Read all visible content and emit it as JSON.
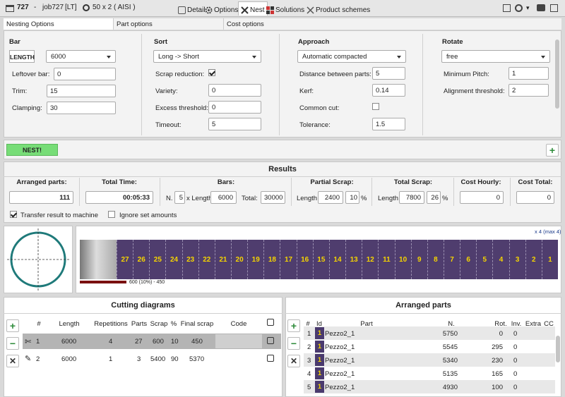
{
  "titlebar": {
    "job_number": "727",
    "dash": "-",
    "job_name": "job727",
    "job_tag": "[LT]",
    "profile": "50 x 2 ( AISI )",
    "tabs": [
      {
        "label": "Detail"
      },
      {
        "label": "Options"
      },
      {
        "label": "Nest"
      },
      {
        "label": "Solutions"
      },
      {
        "label": "Product schemes"
      }
    ]
  },
  "subtabs": [
    "Nesting Options",
    "Part options",
    "Cost options"
  ],
  "bar": {
    "header": "Bar",
    "length_btn": "LENGTH",
    "length_value": "6000",
    "leftover_label": "Leftover bar:",
    "leftover_value": "0",
    "trim_label": "Trim:",
    "trim_value": "15",
    "clamping_label": "Clamping:",
    "clamping_value": "30"
  },
  "sort": {
    "header": "Sort",
    "select": "Long -> Short",
    "scrap_label": "Scrap reduction:",
    "scrap_checked": true,
    "variety_label": "Variety:",
    "variety_value": "0",
    "excess_label": "Excess threshold:",
    "excess_value": "0",
    "timeout_label": "Timeout:",
    "timeout_value": "5"
  },
  "approach": {
    "header": "Approach",
    "select": "Automatic compacted",
    "distance_label": "Distance between parts:",
    "distance_value": "5",
    "kerf_label": "Kerf:",
    "kerf_value": "0.14",
    "common_label": "Common cut:",
    "common_checked": false,
    "tolerance_label": "Tolerance:",
    "tolerance_value": "1.5"
  },
  "rotate": {
    "header": "Rotate",
    "select": "free",
    "min_pitch_label": "Minimum Pitch:",
    "min_pitch_value": "1",
    "align_label": "Alignment threshold:",
    "align_value": "2"
  },
  "nest_button": "NEST!",
  "results": {
    "title": "Results",
    "arranged_label": "Arranged parts:",
    "arranged_value": "111",
    "time_label": "Total Time:",
    "time_value": "00:05:33",
    "bars_label": "Bars:",
    "bars_n_label": "N.",
    "bars_n": "5",
    "bars_xlen_label": "x Length",
    "bars_len": "6000",
    "bars_total_label": "Total:",
    "bars_total": "30000",
    "partial_label": "Partial Scrap:",
    "partial_len_label": "Length",
    "partial_len": "2400",
    "partial_pct": "10",
    "pct": "%",
    "total_scrap_label": "Total Scrap:",
    "total_len_label": "Length",
    "total_len": "7800",
    "total_pct": "26",
    "cost_hourly_label": "Cost   Hourly:",
    "cost_hourly": "0",
    "cost_total_label": "Cost   Total:",
    "cost_total": "0",
    "transfer_label": "Transfer result to machine",
    "transfer_checked": true,
    "ignore_label": "Ignore set amounts",
    "ignore_checked": false
  },
  "bar_preview": {
    "multiplier": "x 4 (max 4)",
    "scrap_caption": "600  (10%) - 450",
    "parts": [
      "27",
      "26",
      "25",
      "24",
      "23",
      "22",
      "21",
      "20",
      "19",
      "18",
      "17",
      "16",
      "15",
      "14",
      "13",
      "12",
      "11",
      "10",
      "9",
      "8",
      "7",
      "6",
      "5",
      "4",
      "3",
      "2",
      "1"
    ],
    "fill_color": "#4f3d6e",
    "text_color": "#f5d400"
  },
  "cutting": {
    "title": "Cutting diagrams",
    "headers": [
      "#",
      "Length",
      "Repetitions",
      "Parts",
      "Scrap",
      "%",
      "Final scrap",
      "Code"
    ],
    "rows": [
      [
        "1",
        "6000",
        "4",
        "27",
        "600",
        "10",
        "450",
        ""
      ],
      [
        "2",
        "6000",
        "1",
        "3",
        "5400",
        "90",
        "5370",
        ""
      ]
    ]
  },
  "arranged": {
    "title": "Arranged parts",
    "headers": [
      "#",
      "Id",
      "Part",
      "N.",
      "Rot.",
      "Inv.",
      "Extra",
      "CC"
    ],
    "rows": [
      [
        "1",
        "1",
        "Pezzo2_1",
        "5750",
        "0",
        "0"
      ],
      [
        "2",
        "1",
        "Pezzo2_1",
        "5545",
        "295",
        "0"
      ],
      [
        "3",
        "1",
        "Pezzo2_1",
        "5340",
        "230",
        "0"
      ],
      [
        "4",
        "1",
        "Pezzo2_1",
        "5135",
        "165",
        "0"
      ],
      [
        "5",
        "1",
        "Pezzo2_1",
        "4930",
        "100",
        "0"
      ]
    ]
  },
  "colors": {
    "nest_green": "#77dd77",
    "add_green": "#2e8b3a",
    "id_badge": "#4a3a6e",
    "circle": "#1f7a7a"
  }
}
